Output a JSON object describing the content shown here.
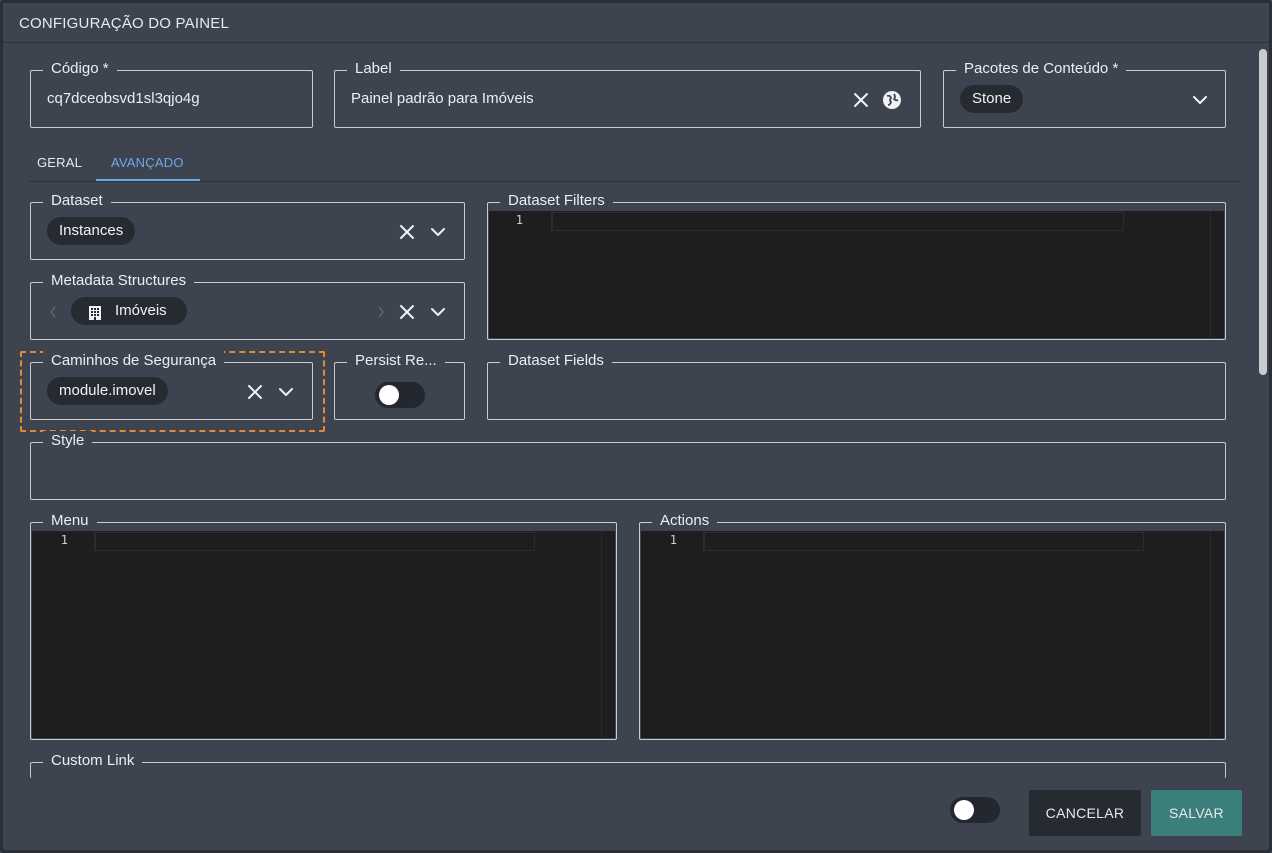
{
  "dialog": {
    "title": "CONFIGURAÇÃO DO PAINEL"
  },
  "fields": {
    "codigo": {
      "label": "Código *",
      "value": "cq7dceobsvd1sl3qjo4g"
    },
    "label": {
      "label": "Label",
      "value": "Painel padrão para Imóveis",
      "clear_icon": "close-icon",
      "lang_icon": "globe-icon"
    },
    "pacotes": {
      "label": "Pacotes de Conteúdo *",
      "chip": "Stone",
      "dropdown_icon": "chevron-down-icon"
    }
  },
  "tabs": [
    {
      "label": "GERAL",
      "active": false
    },
    {
      "label": "AVANÇADO",
      "active": true
    }
  ],
  "advanced": {
    "dataset": {
      "label": "Dataset",
      "chip": "Instances"
    },
    "dataset_filters": {
      "label": "Dataset Filters",
      "line": "1"
    },
    "metadata_structures": {
      "label": "Metadata Structures",
      "chip": "Imóveis",
      "chip_icon": "building-icon"
    },
    "caminhos": {
      "label": "Caminhos de Segurança",
      "chip": "module.imovel"
    },
    "persist": {
      "label": "Persist Re...",
      "toggle_on": false
    },
    "dataset_fields": {
      "label": "Dataset Fields"
    },
    "style": {
      "label": "Style"
    },
    "menu": {
      "label": "Menu",
      "line": "1"
    },
    "actions": {
      "label": "Actions",
      "line": "1"
    },
    "custom_link": {
      "label": "Custom Link"
    }
  },
  "footer": {
    "toggle_on": false,
    "cancel_label": "CANCELAR",
    "save_label": "SALVAR"
  },
  "colors": {
    "background": "#3d4450",
    "accent": "#6ea6e8",
    "save": "#3b7f7a",
    "focus": "#e0893a"
  }
}
